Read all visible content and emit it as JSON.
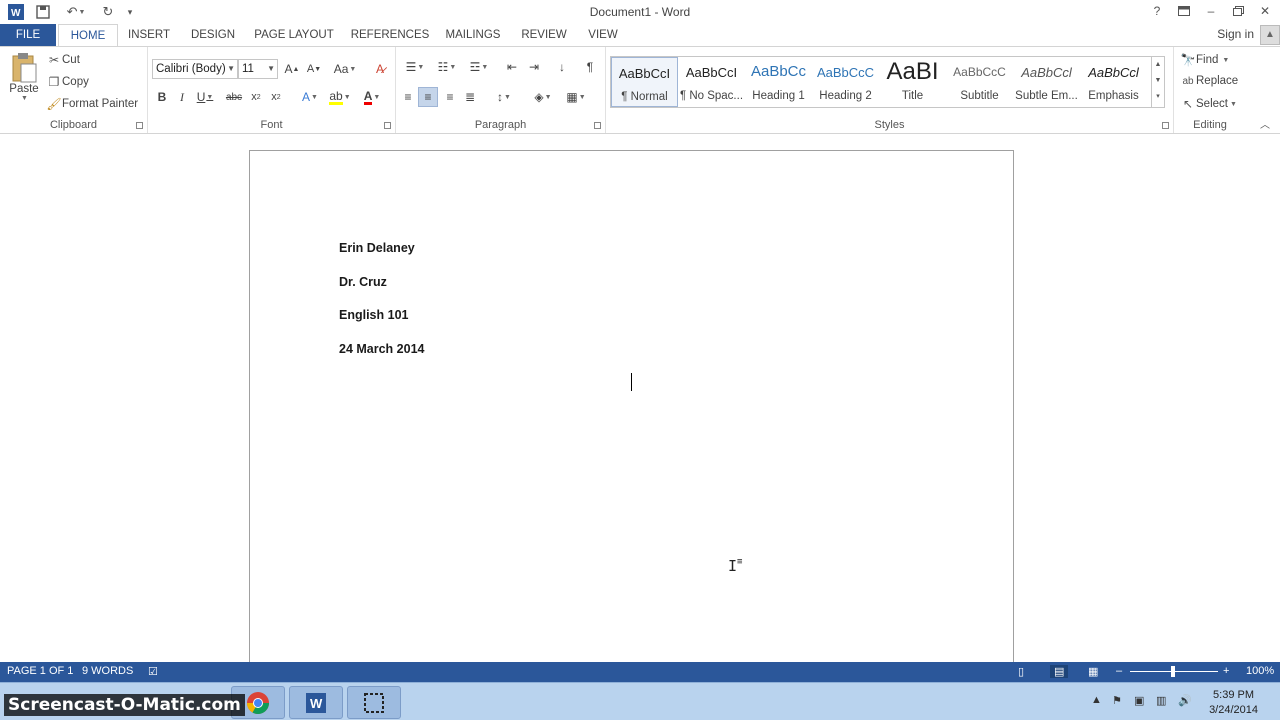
{
  "window": {
    "title": "Document1 - Word"
  },
  "tabs": [
    "FILE",
    "HOME",
    "INSERT",
    "DESIGN",
    "PAGE LAYOUT",
    "REFERENCES",
    "MAILINGS",
    "REVIEW",
    "VIEW"
  ],
  "signin": "Sign in",
  "clipboard": {
    "paste": "Paste",
    "cut": "Cut",
    "copy": "Copy",
    "format_painter": "Format Painter",
    "label": "Clipboard"
  },
  "font": {
    "name": "Calibri (Body)",
    "size": "11",
    "label": "Font"
  },
  "paragraph": {
    "label": "Paragraph"
  },
  "styles": {
    "label": "Styles",
    "items": [
      {
        "sample": "AaBbCcI",
        "name": "¶ Normal"
      },
      {
        "sample": "AaBbCcI",
        "name": "¶ No Spac..."
      },
      {
        "sample": "AaBbCc",
        "name": "Heading 1"
      },
      {
        "sample": "AaBbCcC",
        "name": "Heading 2"
      },
      {
        "sample": "AaBI",
        "name": "Title"
      },
      {
        "sample": "AaBbCcC",
        "name": "Subtitle"
      },
      {
        "sample": "AaBbCcl",
        "name": "Subtle Em..."
      },
      {
        "sample": "AaBbCcl",
        "name": "Emphasis"
      }
    ]
  },
  "editing": {
    "find": "Find",
    "replace": "Replace",
    "select": "Select",
    "label": "Editing"
  },
  "document": {
    "lines": [
      "Erin Delaney",
      "Dr. Cruz",
      "English 101",
      "24 March 2014"
    ]
  },
  "status": {
    "page": "PAGE 1 OF 1",
    "words": "9 WORDS",
    "zoom": "100%"
  },
  "taskbar": {
    "watermark": "Screencast-O-Matic.com",
    "time": "5:39 PM",
    "date": "3/24/2014"
  },
  "colors": {
    "accent": "#2b579a",
    "taskbar": "#b9d3ee"
  }
}
